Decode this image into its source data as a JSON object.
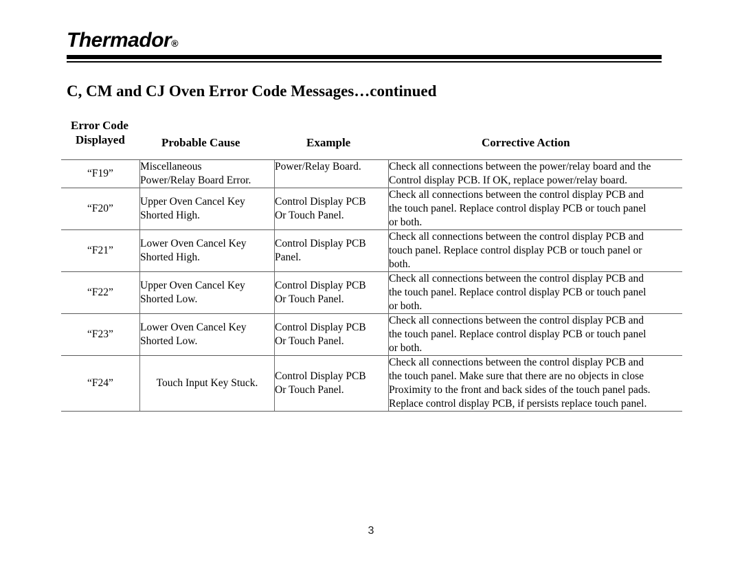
{
  "document": {
    "brand": "Thermador",
    "brand_registered_mark": "®",
    "section_title": "C, CM and CJ Oven Error Code Messages…continued",
    "page_number": "3"
  },
  "table": {
    "headers": {
      "error_code_line1": "Error Code",
      "error_code_line2": "Displayed",
      "probable_cause": "Probable Cause",
      "example": "Example",
      "corrective_action": "Corrective Action"
    },
    "rows": [
      {
        "code": "“F19”",
        "cause": [
          "Miscellaneous",
          "Power/Relay Board Error."
        ],
        "example": [
          "Power/Relay Board."
        ],
        "action": [
          "Check all connections between the power/relay board and the",
          "Control display PCB. If OK, replace power/relay board."
        ]
      },
      {
        "code": "“F20”",
        "cause": [
          "Upper Oven Cancel Key",
          "Shorted High."
        ],
        "example": [
          "Control Display PCB",
          "Or Touch Panel."
        ],
        "action": [
          "Check all connections between the control display PCB and",
          "the touch panel. Replace control display PCB or touch panel",
          "or both."
        ]
      },
      {
        "code": "“F21”",
        "cause": [
          "Lower Oven Cancel Key",
          "Shorted High."
        ],
        "example": [
          "Control Display PCB",
          "Panel."
        ],
        "action": [
          "Check all connections between the control display PCB and",
          "touch panel. Replace control display PCB or touch panel or",
          "both."
        ]
      },
      {
        "code": "“F22”",
        "cause": [
          "Upper Oven Cancel Key",
          "Shorted Low."
        ],
        "example": [
          "Control Display PCB",
          "Or Touch Panel."
        ],
        "action": [
          "Check all connections between the control display PCB and",
          "the touch panel. Replace control display PCB or touch panel",
          "or both."
        ]
      },
      {
        "code": "“F23”",
        "cause": [
          "Lower Oven Cancel Key",
          "Shorted Low."
        ],
        "example": [
          "Control Display PCB",
          "Or Touch Panel."
        ],
        "action": [
          "Check all connections between the control display PCB and",
          "the touch panel. Replace control display PCB or touch panel",
          "or both."
        ]
      },
      {
        "code": "“F24”",
        "cause": [
          "Touch Input Key Stuck."
        ],
        "example": [
          "Control Display PCB",
          "Or Touch Panel."
        ],
        "action": [
          "Check all connections between the control display PCB and",
          "the touch panel. Make sure that there are no objects in close",
          "Proximity to the front and back sides of the touch panel pads.",
          "Replace control display PCB, if persists replace touch panel."
        ]
      }
    ]
  }
}
